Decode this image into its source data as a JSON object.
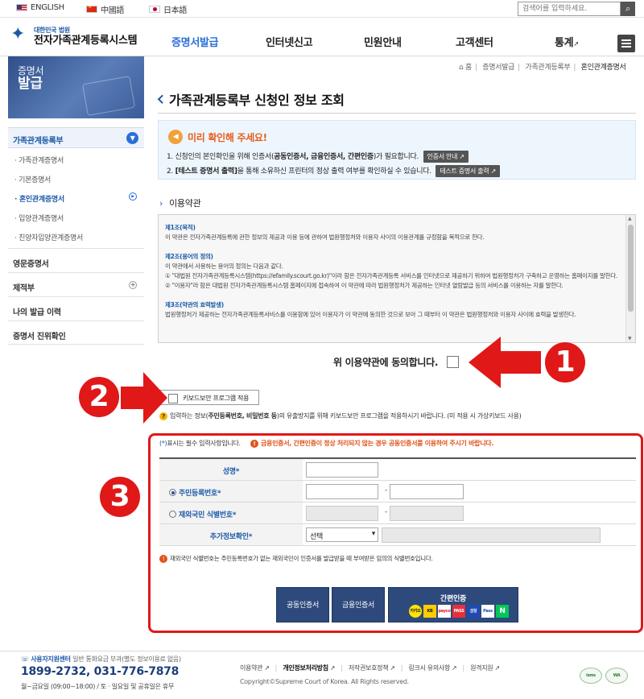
{
  "languages": [
    {
      "label": "ENGLISH",
      "flag": "us-flag-icon"
    },
    {
      "label": "中國語",
      "flag": "cn-flag-icon"
    },
    {
      "label": "日本語",
      "flag": "jp-flag-icon"
    }
  ],
  "search": {
    "placeholder": "검색어를 입력하세요."
  },
  "logo": {
    "small": "대한민국 법원",
    "big": "전자가족관계등록시스템"
  },
  "nav": [
    "증명서발급",
    "인터넷신고",
    "민원안내",
    "고객센터",
    "통계"
  ],
  "nav_ext_icon": "↗",
  "sidebar": {
    "banner": {
      "line1": "증명서",
      "line2": "발급"
    },
    "section": "가족관계등록부",
    "subitems": [
      "가족관계증명서",
      "기본증명서",
      "혼인관계증명서",
      "입양관계증명서",
      "친양자입양관계증명서"
    ],
    "main_items": [
      "영문증명서",
      "제적부",
      "나의 발급 이력",
      "증명서 진위확인"
    ]
  },
  "breadcrumb": {
    "home": "홈",
    "items": [
      "증명서발급",
      "가족관계등록부",
      "혼인관계증명서"
    ]
  },
  "page_title": "가족관계등록부 신청인 정보 조회",
  "notice": {
    "title": "미리 확인해 주세요!",
    "line1_a": "1. 신청인의 본인확인을 위해 인증서(",
    "line1_b": "공동인증서, 금융인증서, 간편인증",
    "line1_c": ")가 필요합니다.",
    "line1_btn": "인증서 안내",
    "line2_a": "2. ",
    "line2_b": "[테스트 증명서 출력]",
    "line2_c": "을 통해 소유하신 프린터의 정상 출력 여부를 확인하실 수 있습니다.",
    "line2_btn": "테스트 증명서 출력"
  },
  "terms": {
    "heading": "이용약관",
    "a1_title": "제1조(목적)",
    "a1_body": "이 약관은 전자가족관계등록에 관한 정보의 제공과 이용 등에 관하여 법원행정처와 이용자 사이의 이용관계를 규정함을 목적으로 한다.",
    "a2_title": "제2조(용어의 정의)",
    "a2_body1": "이 약관에서 사용하는 용어의 정의는 다음과 같다.",
    "a2_body2": "① \"대법원 전자가족관계등록시스템(https://efamily.scourt.go.kr)\"이라 함은 전자가족관계등록 서비스를 인터넷으로 제공하기 위하여 법원행정처가 구축하고 운영하는 홈페이지를 말한다.",
    "a2_body3": "② \"이용자\"라 함은 대법원 전자가족관계등록시스템 홈페이지에 접속하여 이 약관에 따라 법원행정처가 제공하는 인터넷 열람발급 등의 서비스를 이용하는 자를 말한다.",
    "a3_title": "제3조(약관의 효력발생)",
    "a3_body": "법원행정처가 제공하는 전자가족관계등록서비스를 이용함에 있어 이용자가 이 약관에 동의한 것으로 보아 그 때부터 이 약관은 법원행정처와 이용자 사이에 효력을 발생한다."
  },
  "agree_label": "위 이용약관에 동의합니다.",
  "keyboard": {
    "button": "키보드보안 프로그램 적용",
    "note_a": "입력하는 정보(",
    "note_b": "주민등록번호, 비밀번호 등",
    "note_c": ")의 유출방지를 위해 키보드보안 프로그램을 적용하시기 바랍니다. (미 적용 시 가상키보드 사용)"
  },
  "form": {
    "req_star": "(*)",
    "req_note": "표시는 필수 입력사항입니다.",
    "warning": "금융인증서, 간편인증이 정상 처리되지 않는 경우 공동인증서를 이용하여 주시기 바랍니다.",
    "rows": {
      "name": "성명",
      "rrn": "주민등록번호",
      "foreign": "재외국민 식별번호",
      "extra": "추가정보확인"
    },
    "star": "*",
    "dash": "-",
    "select_value": "선택",
    "foreign_note": "재외국민 식별번호는 주민등록번호가 없는 재외국민이 인증서를 발급받을 때 부여받은 임의의 식별번호입니다."
  },
  "auth": {
    "joint": "공동인증서",
    "financial": "금융인증서",
    "simple": "간편인증",
    "providers": [
      "카카오",
      "KB",
      "payco",
      "PASS",
      "삼성",
      "Pass",
      "N"
    ]
  },
  "callouts": [
    "1",
    "2",
    "3"
  ],
  "footer": {
    "call_title": "사용자지원센터",
    "call_sub": "일반 통화요금 부과(별도 정보이용료 없음)",
    "phone": "1899-2732, 031-776-7878",
    "hours": "월~금요일 (09:00~18:00) / 토 · 일요일 및 공휴일은 휴무",
    "links": [
      "이용약관",
      "개인정보처리방침",
      "저작권보호정책",
      "링크시 유의사항",
      "원격지원"
    ],
    "copyright": "Copyright©Supreme Court of Korea. All Rights reserved.",
    "badges": [
      "isms",
      "WA"
    ]
  },
  "colors": {
    "primary": "#1b5aa7",
    "accent": "#2b6fd6",
    "callout": "#e01818",
    "warning": "#e0541b",
    "auth_button": "#2e4a7c"
  }
}
